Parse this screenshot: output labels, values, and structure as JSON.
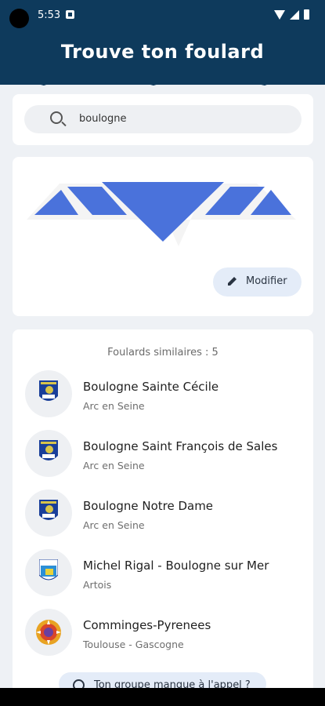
{
  "status_bar": {
    "time": "5:53"
  },
  "header": {
    "title": "Trouve ton foulard"
  },
  "search": {
    "value": "boulogne"
  },
  "scarf": {
    "color": "#4a72db",
    "modify_label": "Modifier"
  },
  "results": {
    "count_label": "Foulards similaires : 5",
    "items": [
      {
        "name": "Boulogne Sainte Cécile",
        "region": "Arc en Seine",
        "icon": "shield-icon"
      },
      {
        "name": "Boulogne Saint François de Sales",
        "region": "Arc en Seine",
        "icon": "shield-icon"
      },
      {
        "name": "Boulogne Notre Dame",
        "region": "Arc en Seine",
        "icon": "shield-icon"
      },
      {
        "name": "Michel Rigal - Boulogne sur Mer",
        "region": "Artois",
        "icon": "shield-icon"
      },
      {
        "name": "Comminges-Pyrenees",
        "region": "Toulouse - Gascogne",
        "icon": "sun-emblem-icon"
      }
    ]
  },
  "footer": {
    "missing_label": "Ton groupe manque à l'appel ?"
  }
}
